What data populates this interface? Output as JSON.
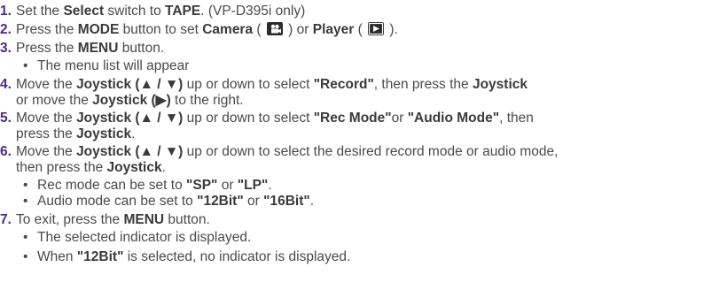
{
  "steps": [
    {
      "num": "1.",
      "parts": [
        "Set the ",
        "Select",
        " switch to ",
        "TAPE",
        ". (VP-D395i only)"
      ]
    },
    {
      "num": "2.",
      "parts": [
        "Press the ",
        "MODE",
        " button to set ",
        "Camera",
        " ( ",
        " ) or ",
        "Player",
        " ( ",
        " )."
      ]
    },
    {
      "num": "3.",
      "parts": [
        "Press the ",
        "MENU",
        " button."
      ]
    },
    {
      "bullet": "The menu list will appear"
    },
    {
      "num": "4.",
      "parts": [
        "Move the ",
        "Joystick (▲ / ▼)",
        " up or down to select ",
        "\"Record\"",
        ", then press the ",
        "Joystick"
      ]
    },
    {
      "cont": [
        "or move the ",
        "Joystick (▶)",
        " to the right."
      ]
    },
    {
      "num": "5.",
      "parts": [
        "Move the ",
        "Joystick (▲ / ▼)",
        " up or down to select ",
        "\"Rec Mode\"",
        "or ",
        "\"Audio Mode\"",
        ", then"
      ]
    },
    {
      "cont": [
        "press the ",
        "Joystick",
        "."
      ]
    },
    {
      "num": "6.",
      "parts": [
        "Move the ",
        "Joystick (▲ / ▼)",
        " up or down to select the desired record mode or audio mode,"
      ]
    },
    {
      "cont": [
        "then press the ",
        "Joystick",
        "."
      ]
    },
    {
      "bullet": [
        "Rec mode can be set to ",
        "\"SP\"",
        " or ",
        "\"LP\"",
        "."
      ]
    },
    {
      "bullet": [
        "Audio mode can be set to ",
        "\"12Bit\"",
        " or ",
        "\"16Bit\"",
        "."
      ]
    },
    {
      "num": "7.",
      "parts": [
        "To exit, press the ",
        "MENU",
        " button."
      ]
    },
    {
      "bullet": "The selected indicator is displayed."
    },
    {
      "bullet": [
        "When ",
        "\"12Bit\"",
        " is selected, no indicator is displayed."
      ]
    }
  ],
  "icons": {
    "camera": "camera-icon",
    "player": "play-icon"
  }
}
